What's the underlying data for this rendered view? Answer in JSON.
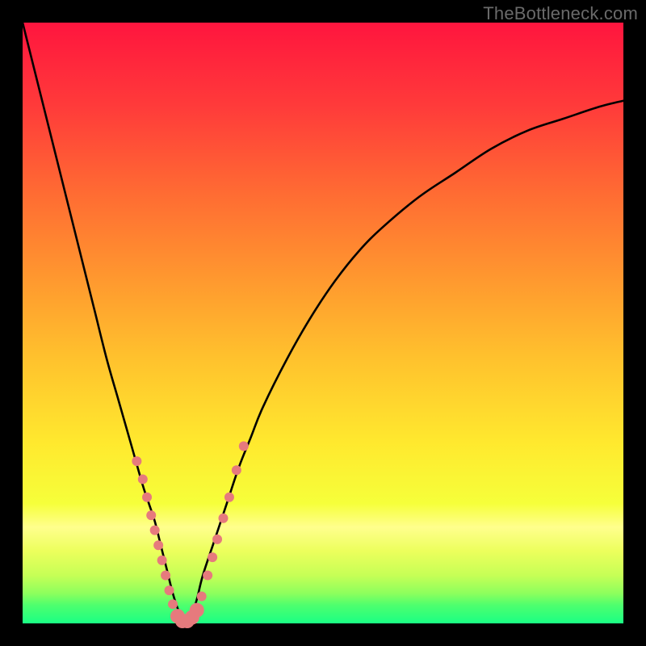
{
  "watermark": {
    "text": "TheBottleneck.com"
  },
  "gradient": {
    "stops": [
      {
        "pct": 0,
        "color": "#ff153e"
      },
      {
        "pct": 14,
        "color": "#ff3b3a"
      },
      {
        "pct": 28,
        "color": "#ff6a33"
      },
      {
        "pct": 42,
        "color": "#ff962f"
      },
      {
        "pct": 56,
        "color": "#ffc22d"
      },
      {
        "pct": 70,
        "color": "#ffe92e"
      },
      {
        "pct": 80,
        "color": "#f6ff3a"
      },
      {
        "pct": 84,
        "color": "#ffff8d"
      },
      {
        "pct": 88,
        "color": "#ecff5c"
      },
      {
        "pct": 92,
        "color": "#c6ff56"
      },
      {
        "pct": 95,
        "color": "#8dff5d"
      },
      {
        "pct": 97,
        "color": "#4dff6e"
      },
      {
        "pct": 100,
        "color": "#1aff84"
      }
    ]
  },
  "curve": {
    "stroke": "#000000",
    "width": 2.6
  },
  "markers": {
    "fill": "#e67a7d",
    "radius_small": 6,
    "radius_large": 9
  },
  "chart_data": {
    "type": "line",
    "title": "",
    "xlabel": "",
    "ylabel": "",
    "x_range": [
      0,
      100
    ],
    "y_range": [
      0,
      100
    ],
    "series": [
      {
        "name": "bottleneck-curve",
        "x": [
          0,
          2,
          4,
          6,
          8,
          10,
          12,
          14,
          16,
          18,
          20,
          21,
          22,
          23,
          24,
          25,
          26,
          27,
          28,
          29,
          30,
          32,
          34,
          36,
          38,
          40,
          44,
          48,
          52,
          56,
          60,
          66,
          72,
          78,
          84,
          90,
          96,
          100
        ],
        "y": [
          100,
          92,
          84,
          76,
          68,
          60,
          52,
          44,
          37,
          30,
          23,
          20,
          17,
          13,
          9,
          5,
          2,
          0,
          1,
          4,
          8,
          14,
          20,
          26,
          31,
          36,
          44,
          51,
          57,
          62,
          66,
          71,
          75,
          79,
          82,
          84,
          86,
          87
        ]
      }
    ],
    "marker_points": {
      "description": "highlighted data points along the curve (approximate % positions)",
      "left_branch": [
        {
          "x": 19,
          "y": 27
        },
        {
          "x": 20,
          "y": 24
        },
        {
          "x": 20.7,
          "y": 21
        },
        {
          "x": 21.4,
          "y": 18
        },
        {
          "x": 22,
          "y": 15.5
        },
        {
          "x": 22.6,
          "y": 13
        },
        {
          "x": 23.2,
          "y": 10.5
        },
        {
          "x": 23.8,
          "y": 8
        },
        {
          "x": 24.4,
          "y": 5.5
        },
        {
          "x": 25,
          "y": 3.2
        }
      ],
      "valley": [
        {
          "x": 25.8,
          "y": 1.2
        },
        {
          "x": 26.6,
          "y": 0.4
        },
        {
          "x": 27.4,
          "y": 0.4
        },
        {
          "x": 28.2,
          "y": 1.0
        },
        {
          "x": 29,
          "y": 2.2
        }
      ],
      "right_branch": [
        {
          "x": 29.8,
          "y": 4.5
        },
        {
          "x": 30.8,
          "y": 8
        },
        {
          "x": 31.6,
          "y": 11
        },
        {
          "x": 32.4,
          "y": 14
        },
        {
          "x": 33.4,
          "y": 17.5
        },
        {
          "x": 34.4,
          "y": 21
        },
        {
          "x": 35.6,
          "y": 25.5
        },
        {
          "x": 36.8,
          "y": 29.5
        }
      ]
    }
  }
}
